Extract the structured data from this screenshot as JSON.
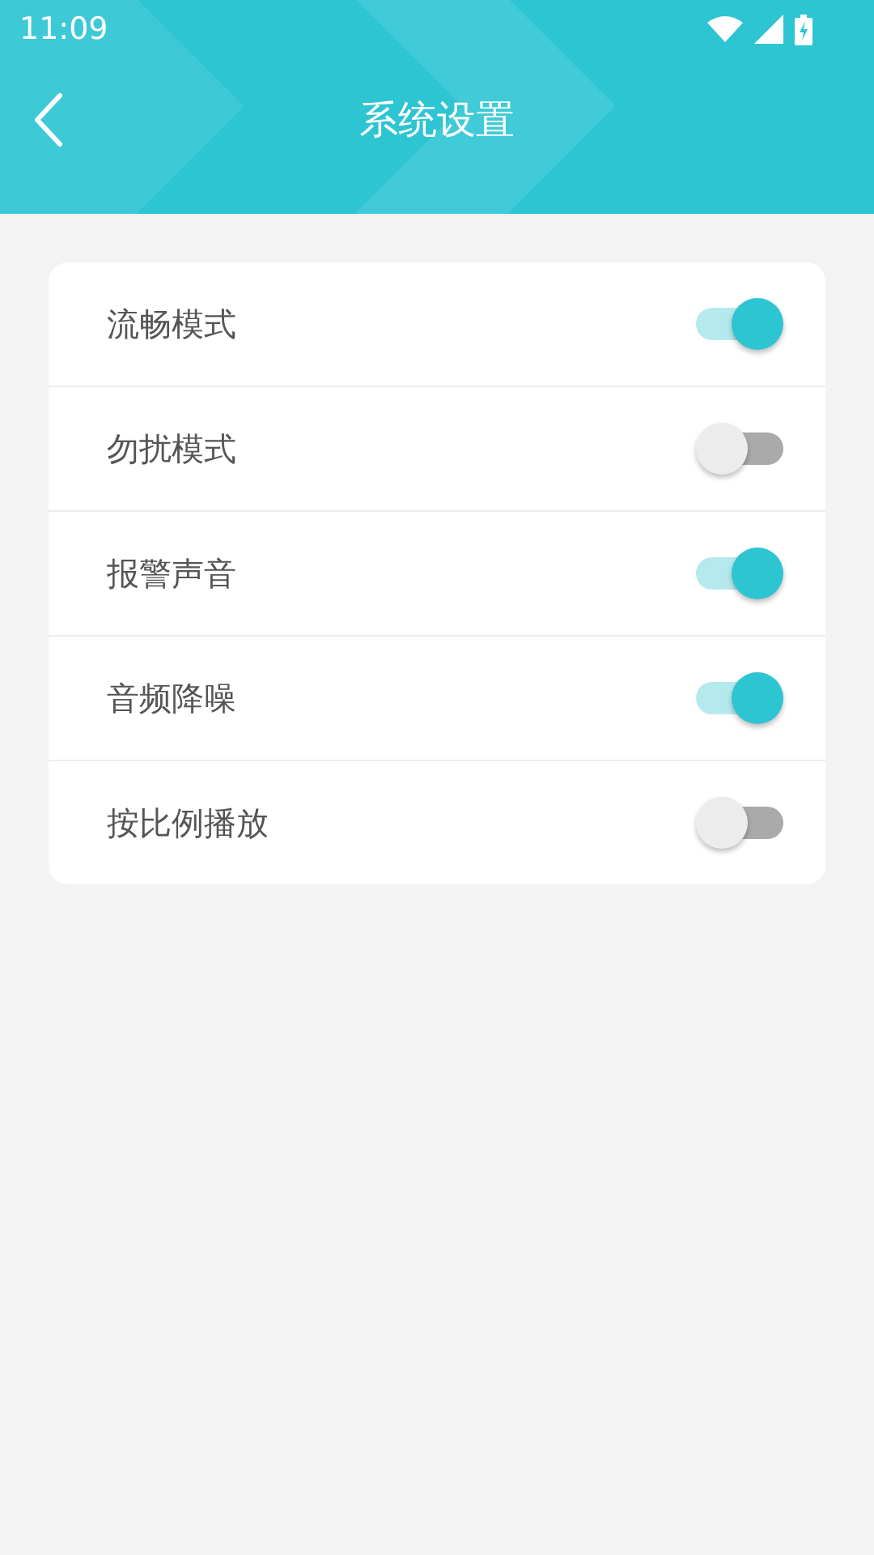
{
  "status_bar": {
    "time": "11:09"
  },
  "header": {
    "title": "系统设置"
  },
  "settings": [
    {
      "label": "流畅模式",
      "on": true
    },
    {
      "label": "勿扰模式",
      "on": false
    },
    {
      "label": "报警声音",
      "on": true
    },
    {
      "label": "音频降噪",
      "on": true
    },
    {
      "label": "按比例播放",
      "on": false
    }
  ]
}
